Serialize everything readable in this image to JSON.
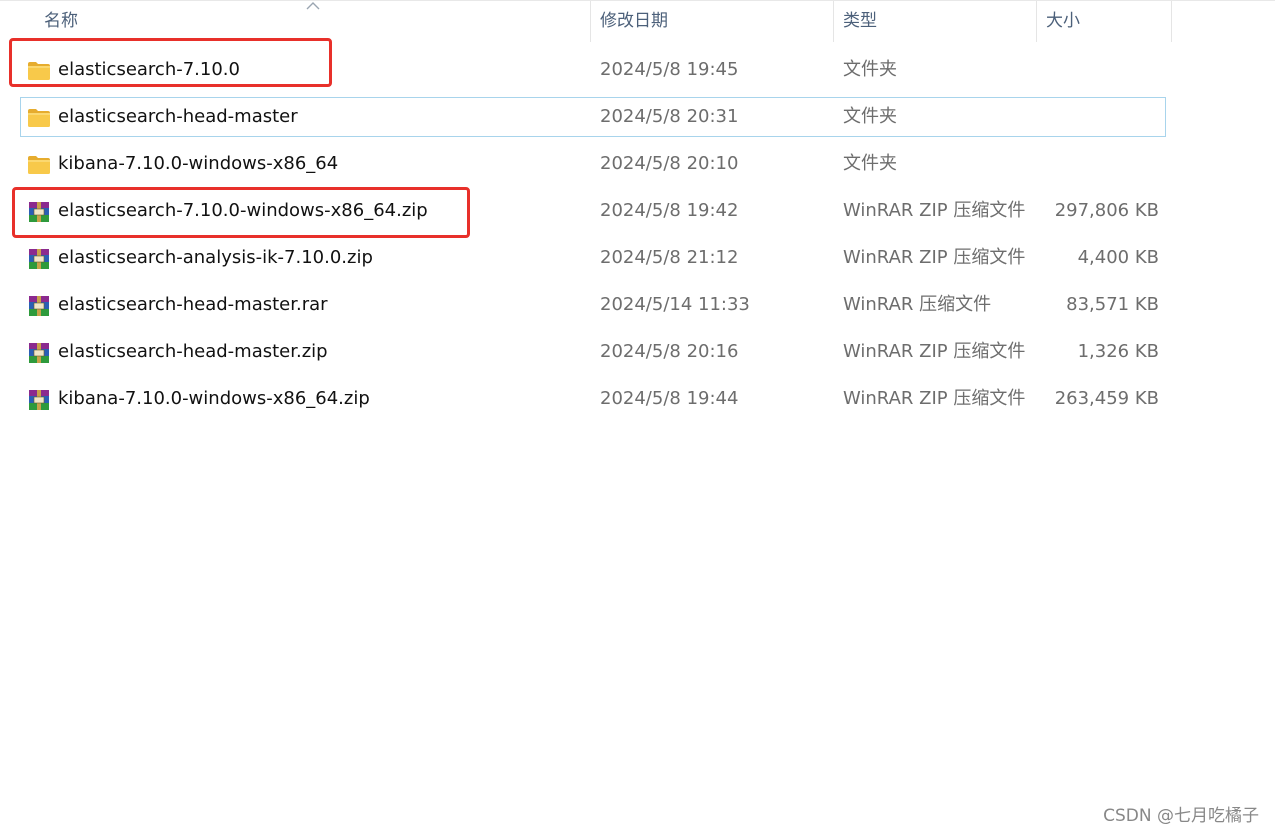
{
  "columns": {
    "name": "名称",
    "date": "修改日期",
    "type": "类型",
    "size": "大小"
  },
  "files": [
    {
      "name": "elasticsearch-7.10.0",
      "date": "2024/5/8 19:45",
      "type": "文件夹",
      "size": "",
      "icon": "folder-icon"
    },
    {
      "name": "elasticsearch-head-master",
      "date": "2024/5/8 20:31",
      "type": "文件夹",
      "size": "",
      "icon": "folder-icon"
    },
    {
      "name": "kibana-7.10.0-windows-x86_64",
      "date": "2024/5/8 20:10",
      "type": "文件夹",
      "size": "",
      "icon": "folder-icon"
    },
    {
      "name": "elasticsearch-7.10.0-windows-x86_64.zip",
      "date": "2024/5/8 19:42",
      "type": "WinRAR ZIP 压缩文件",
      "size": "297,806 KB",
      "icon": "winrar-archive-icon"
    },
    {
      "name": "elasticsearch-analysis-ik-7.10.0.zip",
      "date": "2024/5/8 21:12",
      "type": "WinRAR ZIP 压缩文件",
      "size": "4,400 KB",
      "icon": "winrar-archive-icon"
    },
    {
      "name": "elasticsearch-head-master.rar",
      "date": "2024/5/14 11:33",
      "type": "WinRAR 压缩文件",
      "size": "83,571 KB",
      "icon": "winrar-archive-icon"
    },
    {
      "name": "elasticsearch-head-master.zip",
      "date": "2024/5/8 20:16",
      "type": "WinRAR ZIP 压缩文件",
      "size": "1,326 KB",
      "icon": "winrar-archive-icon"
    },
    {
      "name": "kibana-7.10.0-windows-x86_64.zip",
      "date": "2024/5/8 19:44",
      "type": "WinRAR ZIP 压缩文件",
      "size": "263,459 KB",
      "icon": "winrar-archive-icon"
    }
  ],
  "watermark": "CSDN @七月吃橘子",
  "colors": {
    "folder": "#f8c94a",
    "highlight": "#e8302a",
    "hover_border": "#a8d4ec",
    "header_text": "#4c607a"
  }
}
